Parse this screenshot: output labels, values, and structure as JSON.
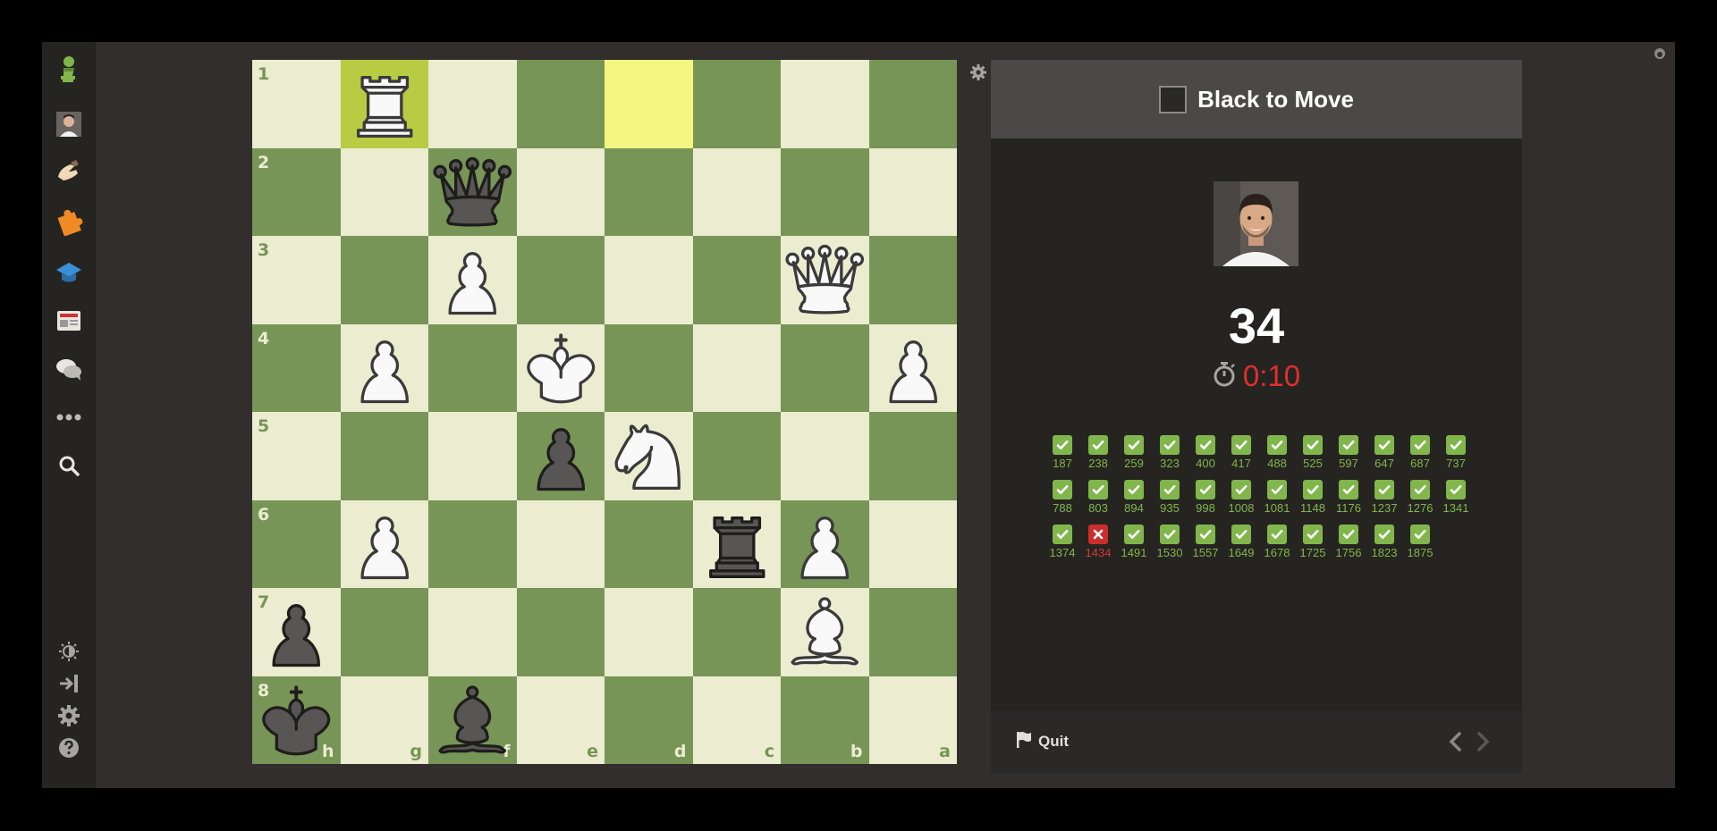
{
  "board": {
    "ranks": [
      "1",
      "2",
      "3",
      "4",
      "5",
      "6",
      "7",
      "8"
    ],
    "files": [
      "h",
      "g",
      "f",
      "e",
      "d",
      "c",
      "b",
      "a"
    ],
    "pieces": [
      {
        "rank": 1,
        "col": 1,
        "type": "rook",
        "color": "white",
        "name": "white-rook"
      },
      {
        "rank": 2,
        "col": 2,
        "type": "queen",
        "color": "black",
        "name": "black-queen"
      },
      {
        "rank": 3,
        "col": 2,
        "type": "pawn",
        "color": "white",
        "name": "white-pawn"
      },
      {
        "rank": 3,
        "col": 6,
        "type": "queen",
        "color": "white",
        "name": "white-queen"
      },
      {
        "rank": 4,
        "col": 1,
        "type": "pawn",
        "color": "white",
        "name": "white-pawn"
      },
      {
        "rank": 4,
        "col": 3,
        "type": "king",
        "color": "white",
        "name": "white-king"
      },
      {
        "rank": 4,
        "col": 7,
        "type": "pawn",
        "color": "white",
        "name": "white-pawn"
      },
      {
        "rank": 5,
        "col": 3,
        "type": "pawn",
        "color": "black",
        "name": "black-pawn"
      },
      {
        "rank": 5,
        "col": 4,
        "type": "knight",
        "color": "white",
        "name": "white-knight"
      },
      {
        "rank": 6,
        "col": 1,
        "type": "pawn",
        "color": "white",
        "name": "white-pawn"
      },
      {
        "rank": 6,
        "col": 5,
        "type": "rook",
        "color": "black",
        "name": "black-rook"
      },
      {
        "rank": 6,
        "col": 6,
        "type": "pawn",
        "color": "white",
        "name": "white-pawn"
      },
      {
        "rank": 7,
        "col": 0,
        "type": "pawn",
        "color": "black",
        "name": "black-pawn"
      },
      {
        "rank": 7,
        "col": 6,
        "type": "bishop",
        "color": "white",
        "name": "white-bishop"
      },
      {
        "rank": 8,
        "col": 0,
        "type": "king",
        "color": "black",
        "name": "black-king"
      },
      {
        "rank": 8,
        "col": 2,
        "type": "bishop",
        "color": "black",
        "name": "black-bishop"
      }
    ],
    "highlights": [
      {
        "rank": 1,
        "col": 1
      },
      {
        "rank": 1,
        "col": 4
      }
    ]
  },
  "panel": {
    "turn": "Black to Move",
    "score": "34",
    "timer": "0:10",
    "quit_label": "Quit"
  },
  "results": [
    {
      "value": "187",
      "ok": true
    },
    {
      "value": "238",
      "ok": true
    },
    {
      "value": "259",
      "ok": true
    },
    {
      "value": "323",
      "ok": true
    },
    {
      "value": "400",
      "ok": true
    },
    {
      "value": "417",
      "ok": true
    },
    {
      "value": "488",
      "ok": true
    },
    {
      "value": "525",
      "ok": true
    },
    {
      "value": "597",
      "ok": true
    },
    {
      "value": "647",
      "ok": true
    },
    {
      "value": "687",
      "ok": true
    },
    {
      "value": "737",
      "ok": true
    },
    {
      "value": "788",
      "ok": true
    },
    {
      "value": "803",
      "ok": true
    },
    {
      "value": "894",
      "ok": true
    },
    {
      "value": "935",
      "ok": true
    },
    {
      "value": "998",
      "ok": true
    },
    {
      "value": "1008",
      "ok": true
    },
    {
      "value": "1081",
      "ok": true
    },
    {
      "value": "1148",
      "ok": true
    },
    {
      "value": "1176",
      "ok": true
    },
    {
      "value": "1237",
      "ok": true
    },
    {
      "value": "1276",
      "ok": true
    },
    {
      "value": "1341",
      "ok": true
    },
    {
      "value": "1374",
      "ok": true
    },
    {
      "value": "1434",
      "ok": false
    },
    {
      "value": "1491",
      "ok": true
    },
    {
      "value": "1530",
      "ok": true
    },
    {
      "value": "1557",
      "ok": true
    },
    {
      "value": "1649",
      "ok": true
    },
    {
      "value": "1678",
      "ok": true
    },
    {
      "value": "1725",
      "ok": true
    },
    {
      "value": "1756",
      "ok": true
    },
    {
      "value": "1823",
      "ok": true
    },
    {
      "value": "1875",
      "ok": true
    }
  ],
  "sidebar": {
    "top_icons": [
      "chess-logo-icon",
      "profile-avatar-icon",
      "play-hand-icon",
      "puzzle-icon",
      "learn-cap-icon",
      "news-icon",
      "chat-bubbles-icon",
      "more-dots-icon",
      "search-icon"
    ],
    "bottom_icons": [
      "brightness-icon",
      "collapse-icon",
      "settings-icon",
      "help-icon"
    ]
  },
  "colors": {
    "light_square": "#ebecd0",
    "dark_square": "#779556",
    "highlight_light": "#f5f682",
    "highlight_dark": "#b9ca43",
    "pass": "#81b64c",
    "fail": "#cc2e2e",
    "timer": "#e0302c"
  }
}
